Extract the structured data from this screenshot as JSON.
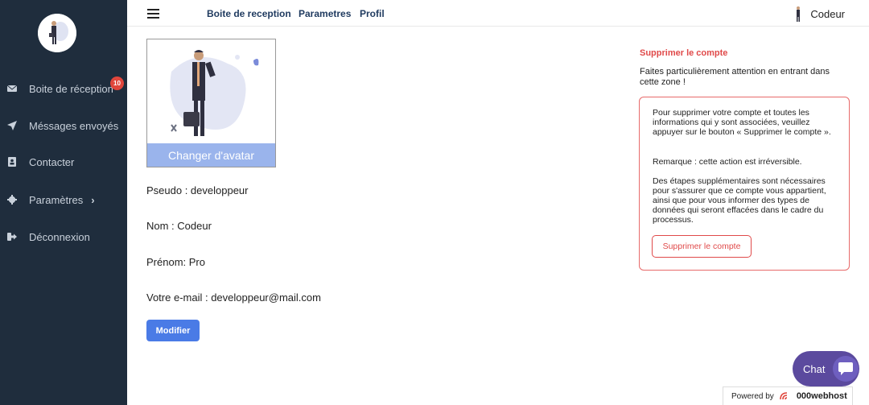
{
  "sidebar": {
    "items": [
      {
        "label": "Boite de réception",
        "icon": "envelope-icon",
        "badge": "10"
      },
      {
        "label": "Méssages envoyés",
        "icon": "paper-plane-icon"
      },
      {
        "label": "Contacter",
        "icon": "address-book-icon"
      },
      {
        "label": "Paramètres",
        "icon": "gear-icon"
      },
      {
        "label": "Déconnexion",
        "icon": "sign-out-icon"
      }
    ]
  },
  "topbar": {
    "links": [
      "Boite de reception",
      "Parametres",
      "Profil"
    ],
    "user_name": "Codeur"
  },
  "profile": {
    "change_avatar": "Changer d'avatar",
    "pseudo": "Pseudo : developpeur",
    "nom": "Nom : Codeur",
    "prenom": "Prénom: Pro",
    "email": "Votre e-mail : developpeur@mail.com",
    "modify_button": "Modifier"
  },
  "danger": {
    "title": "Supprimer le compte",
    "warning": "Faites particulièrement attention en entrant dans cette zone !",
    "para1": "Pour supprimer votre compte et toutes les informations qui y sont associées, veuillez appuyer sur le bouton « Supprimer le compte ».",
    "para2": "Remarque : cette action est irréversible.",
    "para3": "Des étapes supplémentaires sont nécessaires pour s'assurer que ce compte vous appartient, ainsi que pour vous informer des types de données qui seront effacées dans le cadre du processus.",
    "delete_button": "Supprimer le compte"
  },
  "widgets": {
    "chat_label": "Chat",
    "powered_by": "Powered by",
    "host_name": "000webhost"
  },
  "colors": {
    "sidebar_bg": "#1f2d3d",
    "accent": "#4a7be6",
    "danger": "#e04a4a",
    "chat": "#5b4a9e"
  }
}
